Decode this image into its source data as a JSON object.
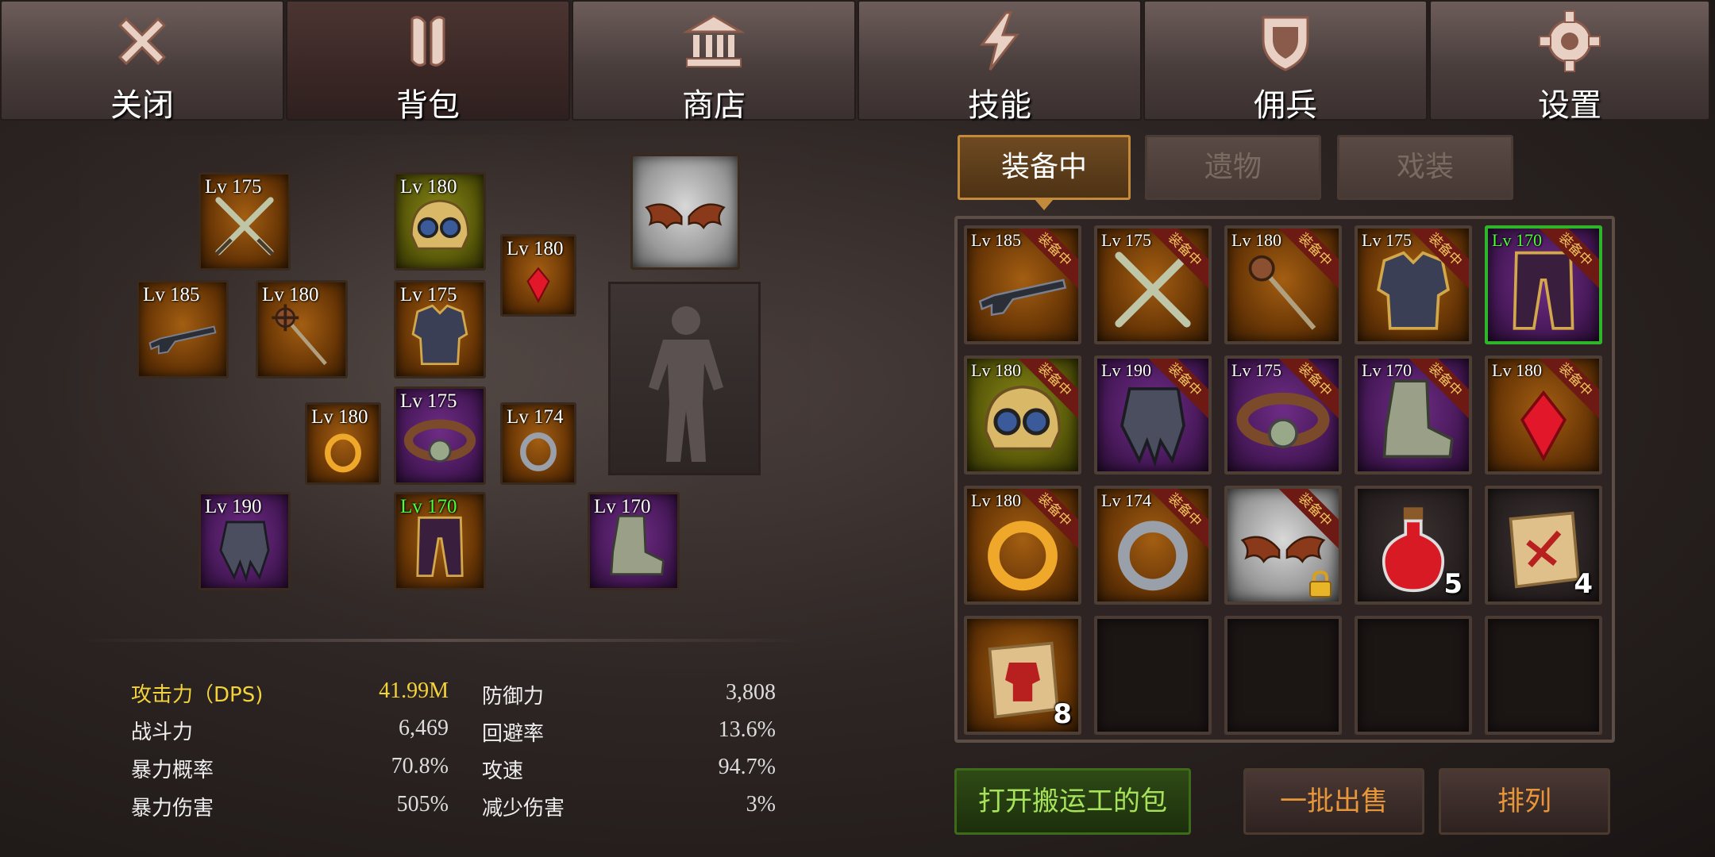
{
  "top_tabs": [
    {
      "label": "关闭",
      "icon": "close-icon"
    },
    {
      "label": "背包",
      "icon": "backpack-icon",
      "active": true
    },
    {
      "label": "商店",
      "icon": "shop-icon"
    },
    {
      "label": "技能",
      "icon": "skill-icon"
    },
    {
      "label": "佣兵",
      "icon": "mercenary-icon"
    },
    {
      "label": "设置",
      "icon": "gear-icon"
    }
  ],
  "equipment_slots": [
    {
      "lv": "Lv 175",
      "item": "crossed-blades-icon",
      "bg": "orange"
    },
    {
      "lv": "Lv 180",
      "item": "goggle-helmet-icon",
      "bg": "olive"
    },
    {
      "lv": "Lv 180",
      "item": "red-crystal-icon",
      "bg": "orange"
    },
    {
      "lv": "",
      "item": "bat-wings-icon",
      "bg": "gray"
    },
    {
      "lv": "Lv 185",
      "item": "shotgun-icon",
      "bg": "orange"
    },
    {
      "lv": "Lv 180",
      "item": "mace-staff-icon",
      "bg": "orange"
    },
    {
      "lv": "Lv 175",
      "item": "chest-armor-icon",
      "bg": "orange"
    },
    {
      "lv": "Lv 180",
      "item": "gold-ring-icon",
      "bg": "orange"
    },
    {
      "lv": "Lv 175",
      "item": "belt-icon",
      "bg": "purple"
    },
    {
      "lv": "Lv 174",
      "item": "silver-ring-icon",
      "bg": "orange"
    },
    {
      "lv": "Lv 190",
      "item": "gauntlet-icon",
      "bg": "purple"
    },
    {
      "lv": "Lv 170",
      "item": "leg-armor-icon",
      "bg": "orange",
      "lv_color": "green"
    },
    {
      "lv": "Lv 170",
      "item": "boots-icon",
      "bg": "purple"
    }
  ],
  "stats": {
    "attack_label": "攻击力（DPS)",
    "attack_value": "41.99M",
    "power_label": "战斗力",
    "power_value": "6,469",
    "crit_rate_label": "暴力概率",
    "crit_rate_value": "70.8%",
    "crit_dmg_label": "暴力伤害",
    "crit_dmg_value": "505%",
    "defense_label": "防御力",
    "defense_value": "3,808",
    "evasion_label": "回避率",
    "evasion_value": "13.6%",
    "attack_speed_label": "攻速",
    "attack_speed_value": "94.7%",
    "dmg_reduce_label": "减少伤害",
    "dmg_reduce_value": "3%"
  },
  "sub_tabs": [
    {
      "label": "装备中",
      "active": true
    },
    {
      "label": "遗物"
    },
    {
      "label": "戏装"
    }
  ],
  "equipped_ribbon": "装备中",
  "inventory": [
    {
      "lv": "Lv 185",
      "item": "shotgun-icon",
      "bg": "orange",
      "equipped": true
    },
    {
      "lv": "Lv 175",
      "item": "crossed-blades-icon",
      "bg": "orange",
      "equipped": true
    },
    {
      "lv": "Lv 180",
      "item": "mace-staff-icon",
      "bg": "orange",
      "equipped": true
    },
    {
      "lv": "Lv 175",
      "item": "chest-armor-icon",
      "bg": "orange",
      "equipped": true
    },
    {
      "lv": "Lv 170",
      "item": "leg-armor-icon",
      "bg": "purple",
      "equipped": true,
      "lv_color": "green",
      "frame": "green"
    },
    {
      "lv": "Lv 180",
      "item": "goggle-helmet-icon",
      "bg": "olive",
      "equipped": true
    },
    {
      "lv": "Lv 190",
      "item": "gauntlet-icon",
      "bg": "purple",
      "equipped": true
    },
    {
      "lv": "Lv 175",
      "item": "belt-icon",
      "bg": "purple",
      "equipped": true
    },
    {
      "lv": "Lv 170",
      "item": "boots-icon",
      "bg": "purple",
      "equipped": true
    },
    {
      "lv": "Lv 180",
      "item": "red-crystal-icon",
      "bg": "orange",
      "equipped": true
    },
    {
      "lv": "Lv 180",
      "item": "gold-ring-icon",
      "bg": "orange",
      "equipped": true
    },
    {
      "lv": "Lv 174",
      "item": "silver-ring-icon",
      "bg": "orange",
      "equipped": true
    },
    {
      "lv": "",
      "item": "bat-wings-icon",
      "bg": "gray",
      "equipped": true,
      "locked": true
    },
    {
      "lv": "",
      "item": "red-potion-icon",
      "bg": "dark",
      "qty": "5"
    },
    {
      "lv": "",
      "item": "sword-scroll-icon",
      "bg": "dark",
      "qty": "4"
    },
    {
      "lv": "",
      "item": "armor-scroll-icon",
      "bg": "orange",
      "qty": "8"
    },
    {
      "empty": true
    },
    {
      "empty": true
    },
    {
      "empty": true
    },
    {
      "empty": true
    }
  ],
  "buttons": {
    "porter_bag": "打开搬运工的包",
    "bulk_sell": "一批出售",
    "sort": "排列"
  }
}
